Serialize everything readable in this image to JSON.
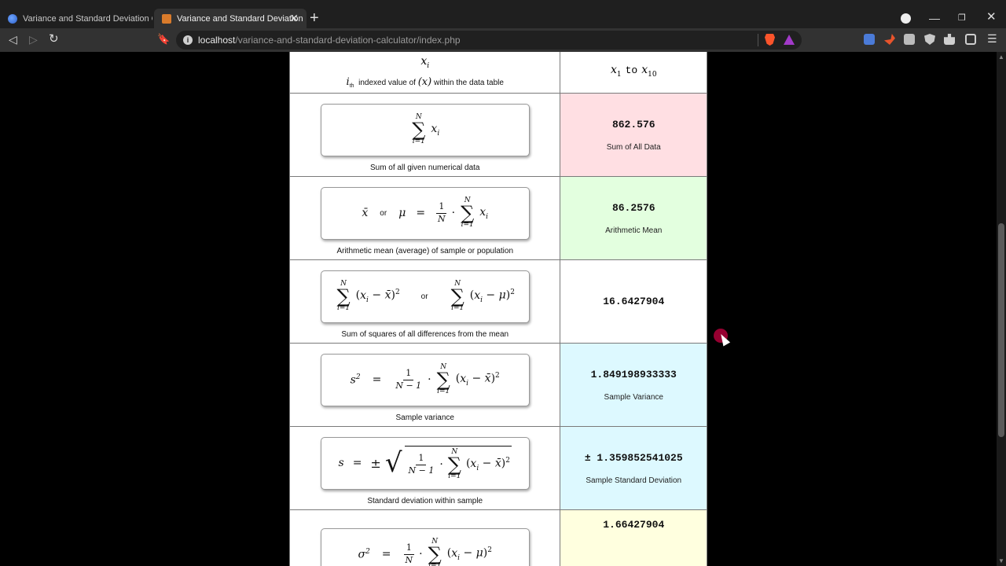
{
  "browser": {
    "tabs": [
      {
        "title": "Variance and Standard Deviation Calcul"
      },
      {
        "title": "Variance and Standard Deviation"
      }
    ],
    "url_host": "localhost",
    "url_path": "/variance-and-standard-deviation-calculator/index.php"
  },
  "rows": {
    "indexed": {
      "symbol": "x",
      "symbol_sub": "i",
      "caption_pre": "i",
      "caption_sub": "th",
      "caption_text": "indexed value of",
      "caption_math": "(x)",
      "caption_post": "within the data table",
      "range_from": "x",
      "range_from_sub": "1",
      "range_to_word": "to",
      "range_to": "x",
      "range_to_sub": "10"
    },
    "sum": {
      "caption": "Sum of all given numerical data",
      "value": "862.576",
      "label": "Sum of All Data"
    },
    "mean": {
      "caption": "Arithmetic mean (average) of sample or population",
      "value": "86.2576",
      "label": "Arithmetic Mean",
      "or": "or"
    },
    "sumsq": {
      "caption": "Sum of squares of all differences from the mean",
      "value": "16.6427904",
      "or": "or"
    },
    "sample_variance": {
      "caption": "Sample variance",
      "value": "1.849198933333",
      "label": "Sample Variance"
    },
    "sample_sd": {
      "caption": "Standard deviation within sample",
      "value": "± 1.35985254102​5",
      "label": "Sample Standard Deviation"
    },
    "pop_variance": {
      "value": "1.66427904"
    }
  }
}
